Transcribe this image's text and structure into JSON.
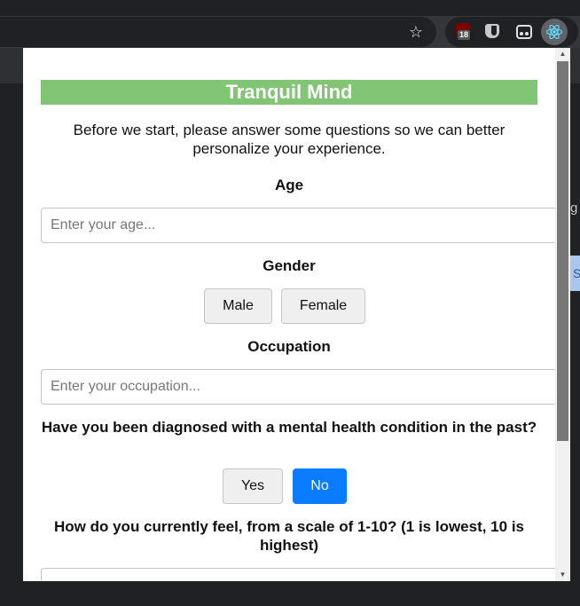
{
  "browser": {
    "ublock_badge": "18",
    "icons": [
      "star-icon",
      "ublock-icon",
      "bitwarden-icon",
      "extension-icon",
      "react-devtools-icon"
    ]
  },
  "background_page": {
    "partial_text": "g",
    "partial_button": "S"
  },
  "popup": {
    "title": "Tranquil Mind",
    "intro": "Before we start, please answer some questions so we can better personalize your experience.",
    "age": {
      "label": "Age",
      "placeholder": "Enter your age..."
    },
    "gender": {
      "label": "Gender",
      "options": [
        "Male",
        "Female"
      ]
    },
    "occupation": {
      "label": "Occupation",
      "placeholder": "Enter your occupation..."
    },
    "diagnosed": {
      "question": "Have you been diagnosed with a mental health condition in the past?",
      "options": [
        "Yes",
        "No"
      ],
      "selected": "No"
    },
    "feeling": {
      "question": "How do you currently feel, from a scale of 1-10? (1 is lowest, 10 is highest)"
    }
  },
  "colors": {
    "title_bar": "#82c675",
    "selected_button": "#0a7cff"
  }
}
